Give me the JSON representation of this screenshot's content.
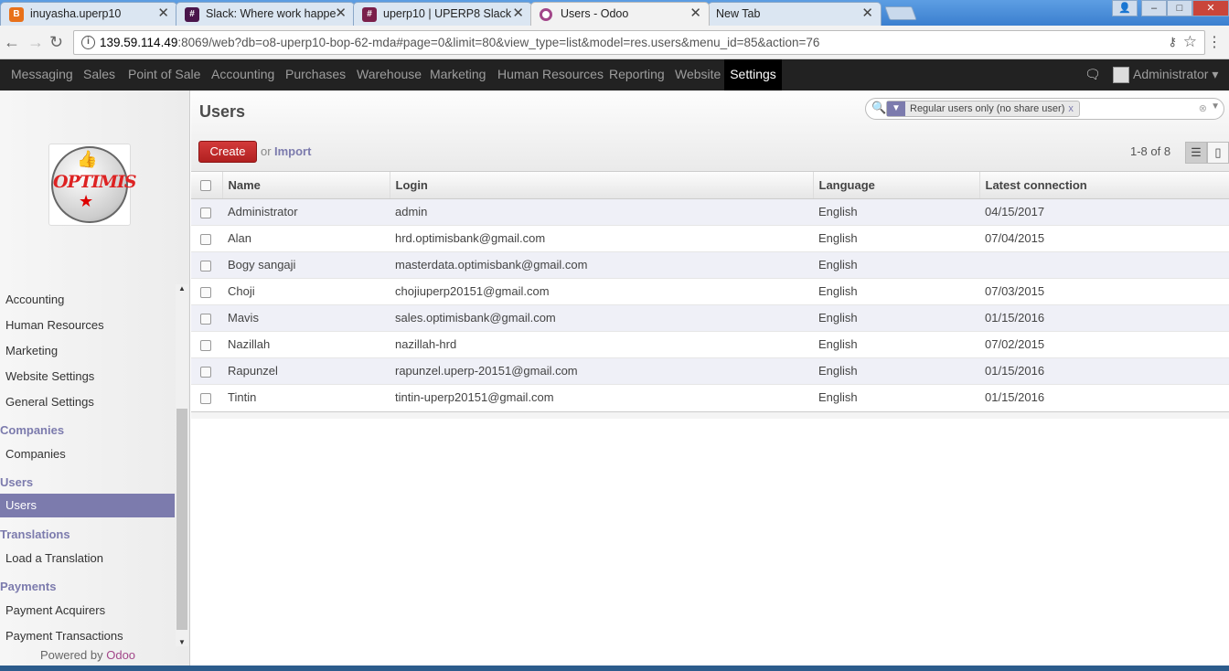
{
  "browser": {
    "tabs": [
      {
        "title": "inuyasha.uperp10",
        "favicon_color": "#e8711a",
        "favicon_glyph": "B"
      },
      {
        "title": "Slack: Where work happe",
        "favicon_color": "#4a154b",
        "favicon_glyph": "#"
      },
      {
        "title": "uperp10 | UPERP8 Slack",
        "favicon_color": "#7a1f4a",
        "favicon_glyph": "#"
      },
      {
        "title": "Users - Odoo",
        "favicon_color": "#a24689",
        "favicon_glyph": "O"
      },
      {
        "title": "New Tab",
        "favicon_color": "",
        "favicon_glyph": ""
      }
    ],
    "url_host": "139.59.114.49",
    "url_rest": ":8069/web?db=o8-uperp10-bop-62-mda#page=0&limit=80&view_type=list&model=res.users&menu_id=85&action=76"
  },
  "topmenu": {
    "items": [
      "Messaging",
      "Sales",
      "Point of Sale",
      "Accounting",
      "Purchases",
      "Warehouse",
      "Marketing",
      "Human Resources",
      "Reporting",
      "Website",
      "Settings"
    ],
    "active": "Settings",
    "user": "Administrator"
  },
  "logo_text": "OPTIMIS",
  "sidebar": {
    "items_top": [
      "Accounting",
      "Human Resources",
      "Marketing",
      "Website Settings",
      "General Settings"
    ],
    "companies_head": "Companies",
    "companies_item": "Companies",
    "users_head": "Users",
    "users_item": "Users",
    "translations_head": "Translations",
    "translations_item": "Load a Translation",
    "payments_head": "Payments",
    "payments_items": [
      "Payment Acquirers",
      "Payment Transactions"
    ],
    "powered_by": "Powered by",
    "powered_brand": "Odoo"
  },
  "content": {
    "title": "Users",
    "search_facet": "Regular users only (no share user)",
    "create_label": "Create",
    "or_label": "or",
    "import_label": "Import",
    "pager": "1-8 of 8",
    "columns": [
      "Name",
      "Login",
      "Language",
      "Latest connection"
    ],
    "rows": [
      {
        "name": "Administrator",
        "login": "admin",
        "language": "English",
        "latest": "04/15/2017"
      },
      {
        "name": "Alan",
        "login": "hrd.optimisbank@gmail.com",
        "language": "English",
        "latest": "07/04/2015"
      },
      {
        "name": "Bogy sangaji",
        "login": "masterdata.optimisbank@gmail.com",
        "language": "English",
        "latest": ""
      },
      {
        "name": "Choji",
        "login": "chojiuperp20151@gmail.com",
        "language": "English",
        "latest": "07/03/2015"
      },
      {
        "name": "Mavis",
        "login": "sales.optimisbank@gmail.com",
        "language": "English",
        "latest": "01/15/2016"
      },
      {
        "name": "Nazillah",
        "login": "nazillah-hrd",
        "language": "English",
        "latest": "07/02/2015"
      },
      {
        "name": "Rapunzel",
        "login": "rapunzel.uperp-20151@gmail.com",
        "language": "English",
        "latest": "01/15/2016"
      },
      {
        "name": "Tintin",
        "login": "tintin-uperp20151@gmail.com",
        "language": "English",
        "latest": "01/15/2016"
      }
    ]
  }
}
